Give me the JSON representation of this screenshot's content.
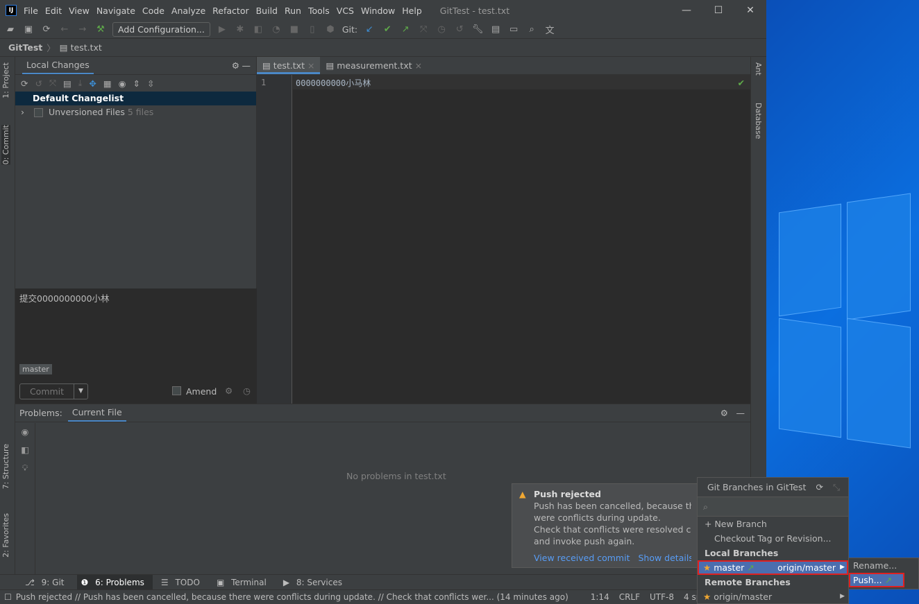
{
  "window": {
    "title": "GitTest - test.txt",
    "minimize": "—",
    "maximize": "☐",
    "close": "✕"
  },
  "menu": [
    "File",
    "Edit",
    "View",
    "Navigate",
    "Code",
    "Analyze",
    "Refactor",
    "Build",
    "Run",
    "Tools",
    "VCS",
    "Window",
    "Help"
  ],
  "toolbar": {
    "add_config": "Add Configuration...",
    "git_label": "Git:"
  },
  "breadcrumb": {
    "project": "GitTest",
    "file": "test.txt"
  },
  "left_stripe": {
    "project": "1: Project",
    "commit": "0: Commit",
    "structure": "7: Structure",
    "favorites": "2: Favorites"
  },
  "right_stripe": {
    "ant": "Ant",
    "database": "Database"
  },
  "commit_panel": {
    "tab": "Local Changes",
    "changelist": "Default Changelist",
    "unversioned": "Unversioned Files",
    "unversioned_count": "5 files",
    "message": "提交0000000000小林",
    "branch": "master",
    "commit_button": "Commit",
    "amend": "Amend"
  },
  "editor": {
    "tabs": [
      "test.txt",
      "measurement.txt"
    ],
    "line_number": "1",
    "line_text": "0000000000小马林"
  },
  "problems": {
    "label": "Problems:",
    "tab": "Current File",
    "empty": "No problems in test.txt"
  },
  "bottom_tabs": [
    "9: Git",
    "6: Problems",
    "TODO",
    "Terminal",
    "8: Services"
  ],
  "status": {
    "message": "Push rejected // Push has been cancelled, because there were conflicts during update. // Check that conflicts wer... (14 minutes ago)",
    "position": "1:14",
    "line_sep": "CRLF",
    "encoding": "UTF-8",
    "indent": "4 spaces"
  },
  "notification": {
    "title": "Push rejected",
    "body1": "Push has been cancelled, because there",
    "body2": "were conflicts during update.",
    "body3": "Check that conflicts were resolved correc",
    "body4": "and invoke push again.",
    "link1": "View received commit",
    "link2": "Show details in"
  },
  "branches": {
    "title": "Git Branches in GitTest",
    "new_branch": "New Branch",
    "checkout": "Checkout Tag or Revision...",
    "local_header": "Local Branches",
    "local": "master",
    "tracking": "origin/master",
    "remote_header": "Remote Branches",
    "remote": "origin/master"
  },
  "submenu": {
    "rename": "Rename...",
    "push": "Push..."
  },
  "colors": {
    "accent": "#4b6eaf",
    "highlight": "#e02020",
    "desktop": "#0b6fe0"
  }
}
